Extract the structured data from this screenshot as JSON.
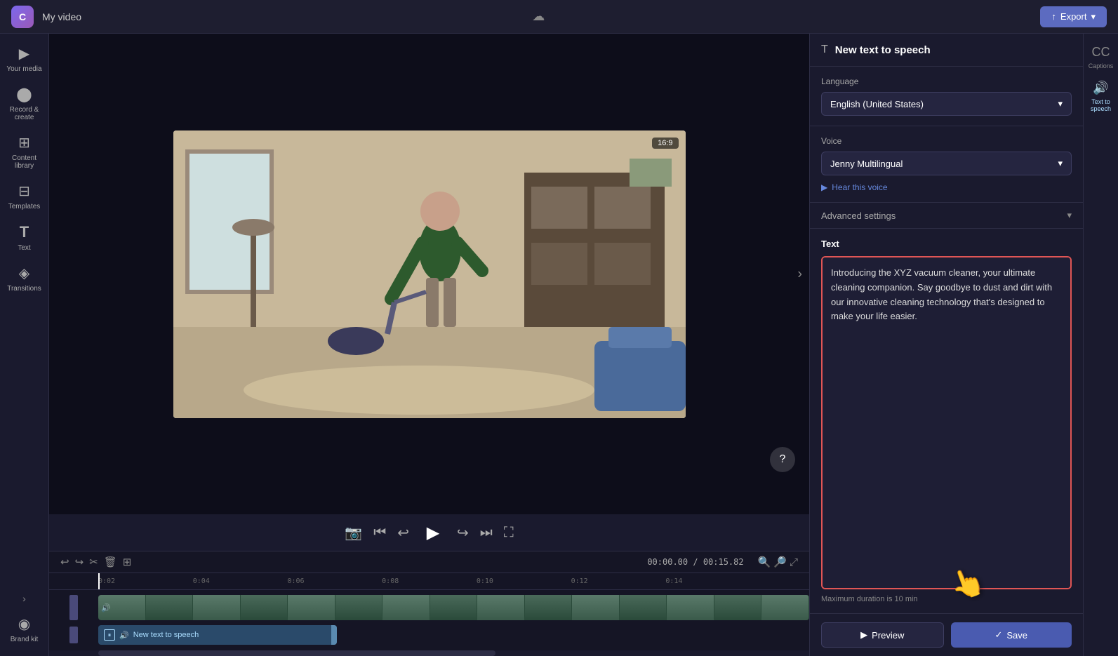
{
  "topbar": {
    "logo": "C",
    "title": "My video",
    "export_label": "Export",
    "export_icon": "↑"
  },
  "sidebar": {
    "items": [
      {
        "id": "your-media",
        "label": "Your media",
        "icon": "▶"
      },
      {
        "id": "record-create",
        "label": "Record & create",
        "icon": "🎥"
      },
      {
        "id": "content-library",
        "label": "Content library",
        "icon": "📚"
      },
      {
        "id": "templates",
        "label": "Templates",
        "icon": "⊞"
      },
      {
        "id": "text",
        "label": "Text",
        "icon": "T"
      },
      {
        "id": "transitions",
        "label": "Transitions",
        "icon": "⬡"
      },
      {
        "id": "brand-kit",
        "label": "Brand kit",
        "icon": "🎨"
      }
    ]
  },
  "video_preview": {
    "aspect_ratio": "16:9"
  },
  "controls": {
    "skip_back": "⏮",
    "rewind": "↩",
    "play": "▶",
    "forward": "↪",
    "skip_forward": "⏭",
    "fullscreen": "⛶",
    "camera_icon": "📷"
  },
  "timeline": {
    "current_time": "00:00.00",
    "total_time": "00:15.82",
    "markers": [
      "0:02",
      "0:04",
      "0:06",
      "0:08",
      "0:10",
      "0:12",
      "0:14"
    ],
    "tts_label": "New text to speech"
  },
  "right_panel": {
    "title": "New text to speech",
    "captions": "Captions",
    "text_to_speech": "Text to speech",
    "language_label": "Language",
    "language_value": "English (United States)",
    "voice_label": "Voice",
    "voice_value": "Jenny Multilingual",
    "hear_voice": "Hear this voice",
    "advanced_settings": "Advanced settings",
    "text_label": "Text",
    "text_content": "Introducing the XYZ vacuum cleaner, your ultimate cleaning companion. Say goodbye to dust and dirt with our innovative cleaning technology that's designed to make your life easier.",
    "max_duration": "Maximum duration is 10 min",
    "preview_label": "Preview",
    "save_label": "Save"
  }
}
